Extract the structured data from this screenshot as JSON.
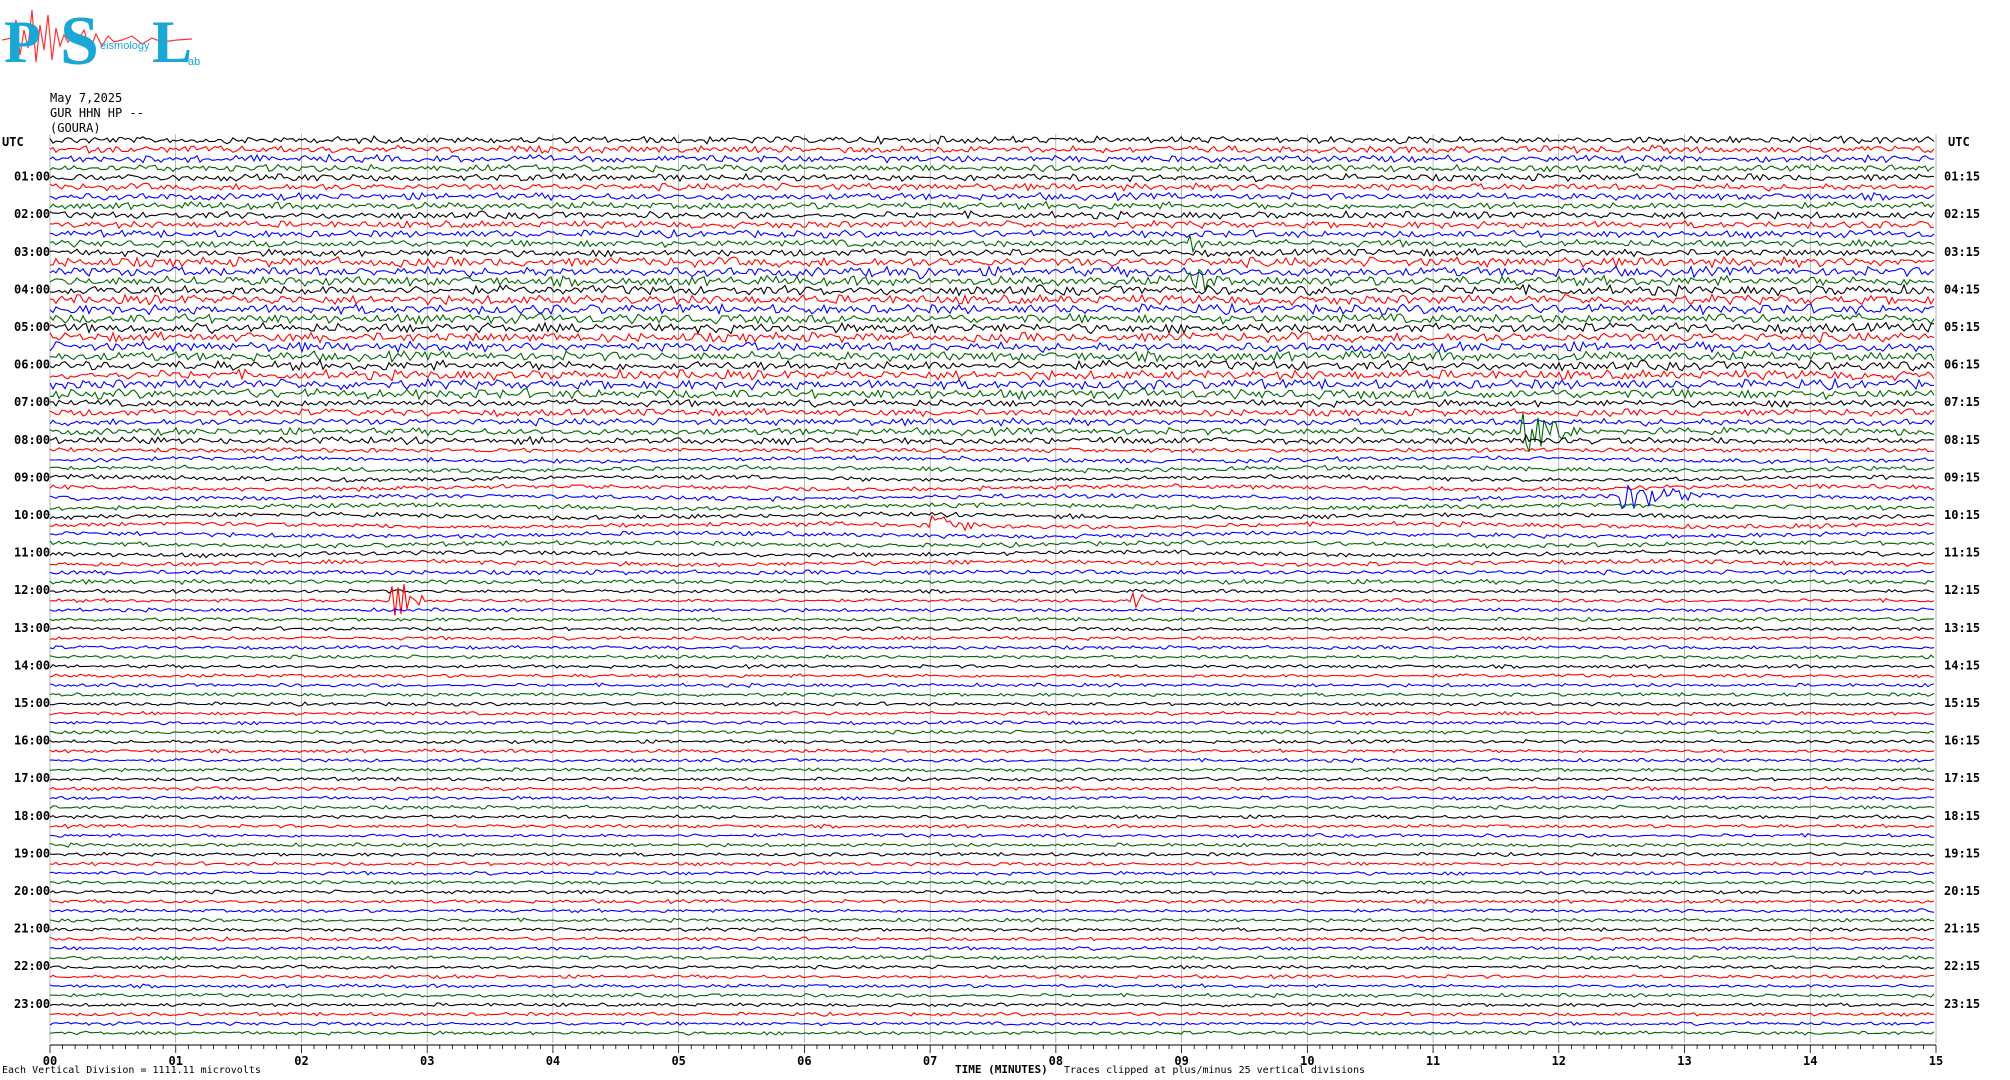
{
  "logo": {
    "initials": [
      "P",
      "S",
      "L"
    ],
    "words": [
      "",
      "eismology",
      "ab"
    ],
    "color": "#1aa7d6"
  },
  "header": {
    "date": "May 7,2025",
    "station": "GUR HHN HP --",
    "site": "(GOURA)"
  },
  "utc_label_left": "UTC",
  "utc_label_right": "UTC",
  "footer": {
    "vertical_division": "Each Vertical Division = 1111.11 microvolts",
    "xlabel": "TIME (MINUTES)",
    "clip_note": "Traces clipped at plus/minus 25 vertical divisions"
  },
  "chart_data": {
    "type": "line",
    "subtype": "helicorder",
    "xlabel": "TIME (MINUTES)",
    "x_ticks": [
      "00",
      "01",
      "02",
      "03",
      "04",
      "05",
      "06",
      "07",
      "08",
      "09",
      "10",
      "11",
      "12",
      "13",
      "14",
      "15"
    ],
    "xlim": [
      0,
      15
    ],
    "minor_ticks_per_minute": 10,
    "left_hour_labels": [
      "01:00",
      "02:00",
      "03:00",
      "04:00",
      "05:00",
      "06:00",
      "07:00",
      "08:00",
      "09:00",
      "10:00",
      "11:00",
      "12:00",
      "13:00",
      "14:00",
      "15:00",
      "16:00",
      "17:00",
      "18:00",
      "19:00",
      "20:00",
      "21:00",
      "22:00",
      "23:00"
    ],
    "right_hour_labels": [
      "01:15",
      "02:15",
      "03:15",
      "04:15",
      "05:15",
      "06:15",
      "07:15",
      "08:15",
      "09:15",
      "10:15",
      "11:15",
      "12:15",
      "13:15",
      "14:15",
      "15:15",
      "16:15",
      "17:15",
      "18:15",
      "19:15",
      "20:15",
      "21:15",
      "22:15",
      "23:15"
    ],
    "lines_per_hour": 4,
    "minutes_per_line": 15,
    "trace_colors": [
      "#000000",
      "#ff0000",
      "#0000ff",
      "#006600"
    ],
    "trace_offsets": [
      "-5318",
      "-5309",
      "-5312",
      "-5297",
      "-5292",
      "-5305",
      "-5296",
      "-5285",
      "-5287",
      "-5286",
      "-5292",
      "-5281",
      "-5290",
      "-5260",
      "-5259",
      "-5265",
      "-5267",
      "-5251",
      "-5220",
      "-5235",
      "-5238",
      "-5236",
      "-5208",
      "-5215",
      "-5130",
      "-5121",
      "-5103",
      "-5144",
      "-5090",
      "-5065",
      "-4935",
      "-4997",
      "-4986",
      "-5073",
      "-4678",
      "-4528",
      "-4743",
      "-4829",
      "-4577",
      "-4311",
      "-4677",
      "-4566",
      "-4652",
      "-5253",
      "-4548",
      "-5320",
      "-5264",
      "-4978",
      "-5096",
      "-5116",
      "-5129",
      "-5227",
      "-5273",
      "-5287",
      "-5345",
      "-5390",
      "-5448",
      "-5484",
      "-5516",
      "-5544",
      "-5599",
      "-5702",
      "-5751",
      "-5773",
      "-5788",
      "-5776",
      "-5771",
      "-5797",
      "-5777",
      "-5721",
      "-5693",
      "-5655",
      "-5637",
      "-5617",
      "-5589",
      "-5535",
      "-5527",
      "-5487",
      "-5495",
      "-5486",
      "-5443",
      "-5438",
      "-5427",
      "-5407",
      "-5399",
      "-5388",
      "-5382",
      "-5376",
      "-5357",
      "-5346",
      "-5318",
      "-5309",
      "-5312",
      "-5297",
      "-5292",
      "-5305"
    ],
    "events": [
      {
        "line": 11,
        "minute": 9.05,
        "color": "#006600",
        "amplitude": 5,
        "duration": 0.25
      },
      {
        "line": 15,
        "minute": 9.05,
        "color": "#006600",
        "amplitude": 9,
        "duration": 0.3
      },
      {
        "line": 14,
        "minute": 6.9,
        "color": "#006600",
        "amplitude": 5,
        "duration": 0.2
      },
      {
        "line": 31,
        "minute": 11.7,
        "color": "#ff0000",
        "amplitude": 12,
        "duration": 0.6
      },
      {
        "line": 32,
        "minute": 11.7,
        "color": "#0000ff",
        "amplitude": 4,
        "duration": 0.2
      },
      {
        "line": 38,
        "minute": 12.5,
        "color": "#000000",
        "amplitude": 7,
        "duration": 0.8
      },
      {
        "line": 41,
        "minute": 7.0,
        "color": "#0000ff",
        "amplitude": 5,
        "duration": 0.6
      },
      {
        "line": 49,
        "minute": 2.7,
        "color": "#0000ff",
        "amplitude": 12,
        "duration": 0.35
      },
      {
        "line": 49,
        "minute": 8.6,
        "color": "#ff0000",
        "amplitude": 6,
        "duration": 0.15
      },
      {
        "line": 97,
        "minute": 14.2,
        "color": "#0000ff",
        "amplitude": 5,
        "duration": 0.5
      }
    ]
  }
}
